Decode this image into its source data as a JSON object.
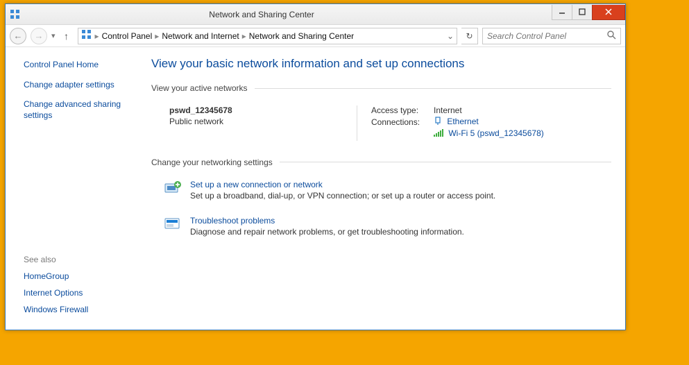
{
  "window": {
    "title": "Network and Sharing Center"
  },
  "breadcrumb": {
    "items": [
      "Control Panel",
      "Network and Internet",
      "Network and Sharing Center"
    ]
  },
  "search": {
    "placeholder": "Search Control Panel"
  },
  "sidebar": {
    "home": "Control Panel Home",
    "tasks": [
      "Change adapter settings",
      "Change advanced sharing settings"
    ],
    "seealso_hdr": "See also",
    "seealso": [
      "HomeGroup",
      "Internet Options",
      "Windows Firewall"
    ]
  },
  "main": {
    "title": "View your basic network information and set up connections",
    "active_hdr": "View your active networks",
    "network": {
      "name": "pswd_12345678",
      "type": "Public network",
      "access_key": "Access type:",
      "access_val": "Internet",
      "conn_key": "Connections:",
      "conn_eth": "Ethernet",
      "conn_wifi": "Wi-Fi 5 (pswd_12345678)"
    },
    "settings_hdr": "Change your networking settings",
    "settings": [
      {
        "link": "Set up a new connection or network",
        "desc": "Set up a broadband, dial-up, or VPN connection; or set up a router or access point."
      },
      {
        "link": "Troubleshoot problems",
        "desc": "Diagnose and repair network problems, or get troubleshooting information."
      }
    ]
  }
}
